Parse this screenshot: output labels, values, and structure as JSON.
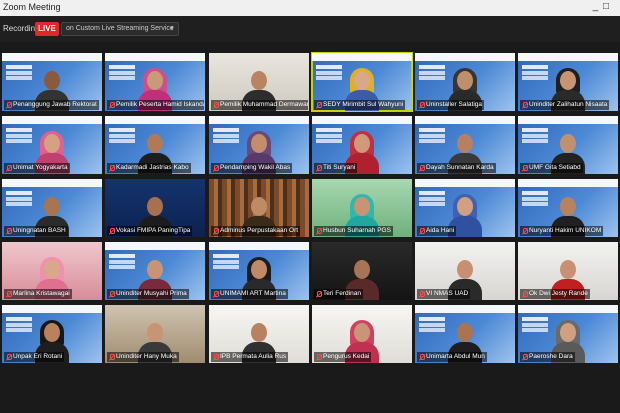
{
  "window": {
    "title": "Zoom Meeting",
    "controls": "_ □"
  },
  "recording": {
    "label": "Recording",
    "live_badge": "LIVE",
    "stream_target": "on Custom Live Streaming Service"
  },
  "colors": {
    "live": "#e02828",
    "active_speaker": "#c8d400",
    "mic_muted": "#ff4a4a"
  },
  "participants": [
    {
      "name": "Penanggung Jawab Rektorat",
      "bg": "bg-slide",
      "skin": "#8a5a3c",
      "cloth": "#333333",
      "hijab": ""
    },
    {
      "name": "Pemilik Peserta Hamid Iskandar",
      "bg": "bg-slide",
      "skin": "#c89a78",
      "cloth": "#c0307a",
      "hijab": "#d04f8a"
    },
    {
      "name": "Pemilik Muhammad Dermawan",
      "bg": "bg-wall",
      "skin": "#b98462",
      "cloth": "#2d2d2d",
      "hijab": ""
    },
    {
      "name": "SEDY Mirimbit Sul Wahyuni",
      "bg": "bg-slide",
      "skin": "#d8a888",
      "cloth": "#3b5da8",
      "hijab": "#e0b020",
      "active": true
    },
    {
      "name": "Uninstaller Salatiga",
      "bg": "bg-slide",
      "skin": "#c08e6c",
      "cloth": "#2a2a2a",
      "hijab": "#353535"
    },
    {
      "name": "Uninditer Zalihatun Nisaata",
      "bg": "bg-slide",
      "skin": "#c89474",
      "cloth": "#2a2a2a",
      "hijab": "#1f1f1f"
    },
    {
      "name": "Unimat Yogyakarta",
      "bg": "bg-slide",
      "skin": "#d4a282",
      "cloth": "#c04070",
      "hijab": "#e06090"
    },
    {
      "name": "Kadarmadi Jastrias Kabo",
      "bg": "bg-slide",
      "skin": "#b07a58",
      "cloth": "#1e1e1e",
      "hijab": ""
    },
    {
      "name": "Pendamping Wakil Abas",
      "bg": "bg-slide",
      "skin": "#c48e6a",
      "cloth": "#5a3a6a",
      "hijab": "#6a4a7a"
    },
    {
      "name": "Titi Suryani",
      "bg": "bg-slide",
      "skin": "#d09a78",
      "cloth": "#b02030",
      "hijab": "#c03040"
    },
    {
      "name": "Dayah Sunnatan Karda",
      "bg": "bg-slide",
      "skin": "#b88060",
      "cloth": "#3a3a3a",
      "hijab": ""
    },
    {
      "name": "UMF Gita Setiabd",
      "bg": "bg-slide",
      "skin": "#c09070",
      "cloth": "#222222",
      "hijab": ""
    },
    {
      "name": "Uningnatan BASH",
      "bg": "bg-slide",
      "skin": "#a87452",
      "cloth": "#2b2b2b",
      "hijab": ""
    },
    {
      "name": "Vokasi FMIPA PaningTipa",
      "bg": "bg-navy",
      "skin": "#a8704e",
      "cloth": "#1c1c1c",
      "hijab": ""
    },
    {
      "name": "Adminus Perpustakaan Ort",
      "bg": "bg-books",
      "skin": "#c08a64",
      "cloth": "#3a2a1a",
      "hijab": ""
    },
    {
      "name": "Husbun Suharnah PGS",
      "bg": "bg-green",
      "skin": "#c89474",
      "cloth": "#20a8a0",
      "hijab": "#2fb8b0"
    },
    {
      "name": "Aida Hani",
      "bg": "bg-slide",
      "skin": "#d0a080",
      "cloth": "#3050a0",
      "hijab": "#4060b0"
    },
    {
      "name": "Nuryanti Hakim UNIKOM",
      "bg": "bg-slide",
      "skin": "#b8825e",
      "cloth": "#202020",
      "hijab": ""
    },
    {
      "name": "Marlina Kristawagai",
      "bg": "bg-pink",
      "skin": "#d8a888",
      "cloth": "#e07090",
      "hijab": "#f090b0"
    },
    {
      "name": "Uninditer Musyahi Prima",
      "bg": "bg-slide",
      "skin": "#c89474",
      "cloth": "#7a2a3a",
      "hijab": ""
    },
    {
      "name": "UNIMAMI ART Martina",
      "bg": "bg-slide",
      "skin": "#c08a68",
      "cloth": "#2a2a2a",
      "hijab": "#1c1c1c"
    },
    {
      "name": "Teri Ferdinan",
      "bg": "bg-dark",
      "skin": "#a87456",
      "cloth": "#5a2a2a",
      "hijab": ""
    },
    {
      "name": "VI NMAS UAD",
      "bg": "bg-room",
      "skin": "#c89070",
      "cloth": "#2a2a2a",
      "hijab": ""
    },
    {
      "name": "Ok Dwi Jesty Rande",
      "bg": "bg-room",
      "skin": "#c89272",
      "cloth": "#c02020",
      "hijab": ""
    },
    {
      "name": "Unpak Eri Rotani",
      "bg": "bg-slide",
      "skin": "#b8825e",
      "cloth": "#1e1e1e",
      "hijab": "#161616"
    },
    {
      "name": "Uninditer Hany Muka",
      "bg": "bg-warm",
      "skin": "#c89474",
      "cloth": "#3a3a3a",
      "hijab": ""
    },
    {
      "name": "IPB Permata Aulia Rus",
      "bg": "bg-light",
      "skin": "#b88262",
      "cloth": "#303030",
      "hijab": ""
    },
    {
      "name": "Pengurus Kedai",
      "bg": "bg-light",
      "skin": "#c89676",
      "cloth": "#c03050",
      "hijab": "#d04060"
    },
    {
      "name": "Unimarta Abdul Mun",
      "bg": "bg-slide",
      "skin": "#a87452",
      "cloth": "#1e1e1e",
      "hijab": ""
    },
    {
      "name": "Paeroshe Dara",
      "bg": "bg-slide",
      "skin": "#d0a080",
      "cloth": "#5a5a5a",
      "hijab": "#6a6a6a"
    }
  ]
}
